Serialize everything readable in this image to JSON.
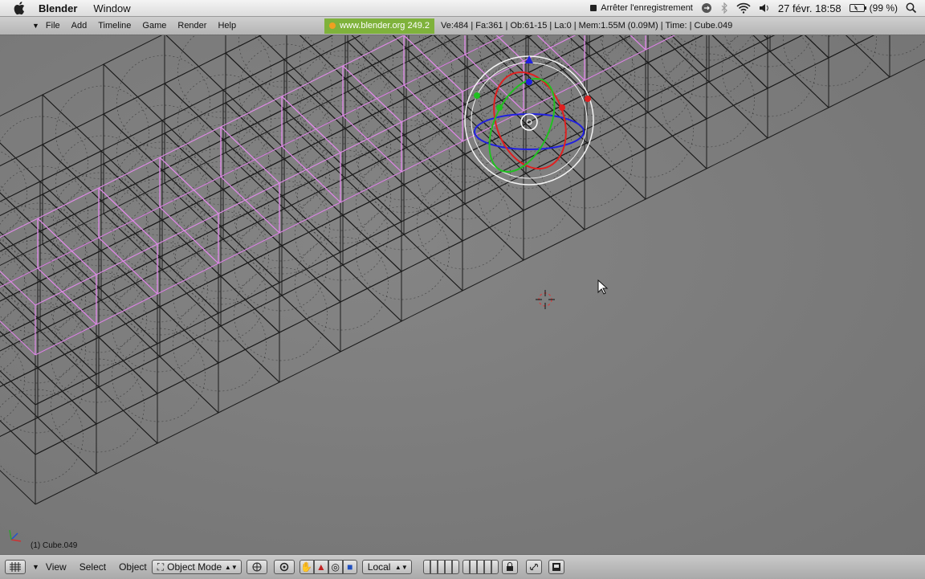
{
  "macbar": {
    "app_name": "Blender",
    "menus": [
      "Window"
    ],
    "recording": "Arrêter l'enregistrement",
    "clock": "27 févr.  18:58",
    "battery": "(99 %)",
    "icons": [
      "apple-icon",
      "record-icon",
      "sync-icon",
      "bluetooth-icon",
      "wifi-icon",
      "volume-icon",
      "battery-icon",
      "spotlight-icon"
    ]
  },
  "header": {
    "menus": [
      "File",
      "Add",
      "Timeline",
      "Game",
      "Render",
      "Help"
    ],
    "blender_link": "www.blender.org 249.2",
    "stats": "Ve:484 | Fa:361 | Ob:61-15 | La:0   | Mem:1.55M (0.09M)  | Time:  | Cube.049"
  },
  "viewport": {
    "object_label": "(1) Cube.049",
    "colors": {
      "background": "#7b7b7b",
      "wire": "#1c1c1c",
      "selected": "#e08ae8",
      "x_axis": "#e02020",
      "y_axis": "#20c020",
      "z_axis": "#2020e0"
    }
  },
  "bottom": {
    "view": "View",
    "select": "Select",
    "object": "Object",
    "mode": "Object Mode",
    "orientation": "Local"
  }
}
